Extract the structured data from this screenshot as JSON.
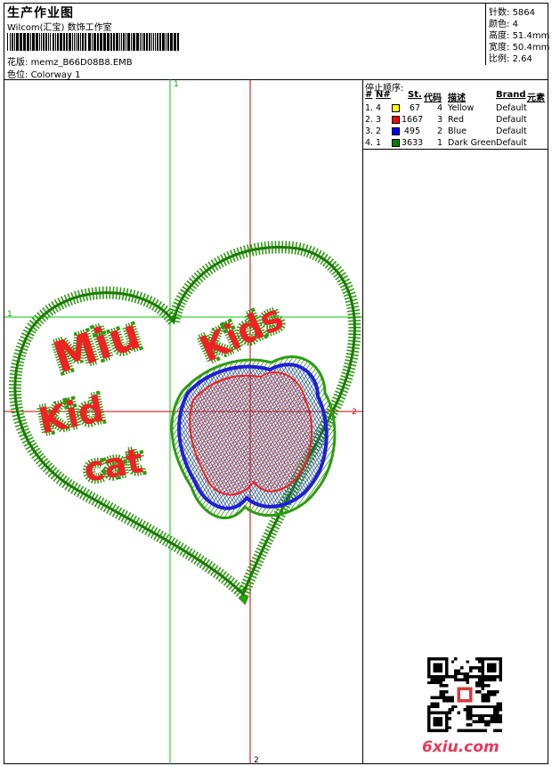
{
  "header": {
    "title": "生产作业图",
    "studio": "Wilcom(汇宝) 数饰工作室",
    "design_label": "花版:",
    "design_value": "memz_B66D08B8.EMB",
    "colorway_label": "色位:",
    "colorway_value": "Colorway 1"
  },
  "stats": [
    {
      "label": "针数:",
      "value": "5864"
    },
    {
      "label": "颜色:",
      "value": "4"
    },
    {
      "label": "高度:",
      "value": "51.4mm"
    },
    {
      "label": "宽度:",
      "value": "50.4mm"
    },
    {
      "label": "比例:",
      "value": "2.64"
    }
  ],
  "stop_sequence": {
    "title": "停止顺序:",
    "headers": [
      "#",
      "N#",
      "St.",
      "代码",
      "描述",
      "Brand",
      "元素"
    ],
    "rows": [
      {
        "idx": "1.",
        "n": "4",
        "color": "#ffff00",
        "st": "67",
        "code": "4",
        "desc": "Yellow",
        "brand": "Default"
      },
      {
        "idx": "2.",
        "n": "3",
        "color": "#ff0000",
        "st": "1667",
        "code": "3",
        "desc": "Red",
        "brand": "Default"
      },
      {
        "idx": "3.",
        "n": "2",
        "color": "#0000ff",
        "st": "495",
        "code": "2",
        "desc": "Blue",
        "brand": "Default"
      },
      {
        "idx": "4.",
        "n": "1",
        "color": "#008000",
        "st": "3633",
        "code": "1",
        "desc": "Dark Green",
        "brand": "Default"
      }
    ]
  },
  "axes": {
    "v1": "1",
    "h1": "1",
    "h2": "2",
    "v2": "2",
    "v1_color": "#00cc00",
    "v2_color": "#cc0000"
  },
  "design_text": [
    "Miu",
    "Kids",
    "Kid",
    "cat"
  ],
  "watermark": "6xiu.com",
  "colors": {
    "green": "#2e9c12",
    "red": "#ee2222",
    "blue": "#1f1fd8"
  }
}
